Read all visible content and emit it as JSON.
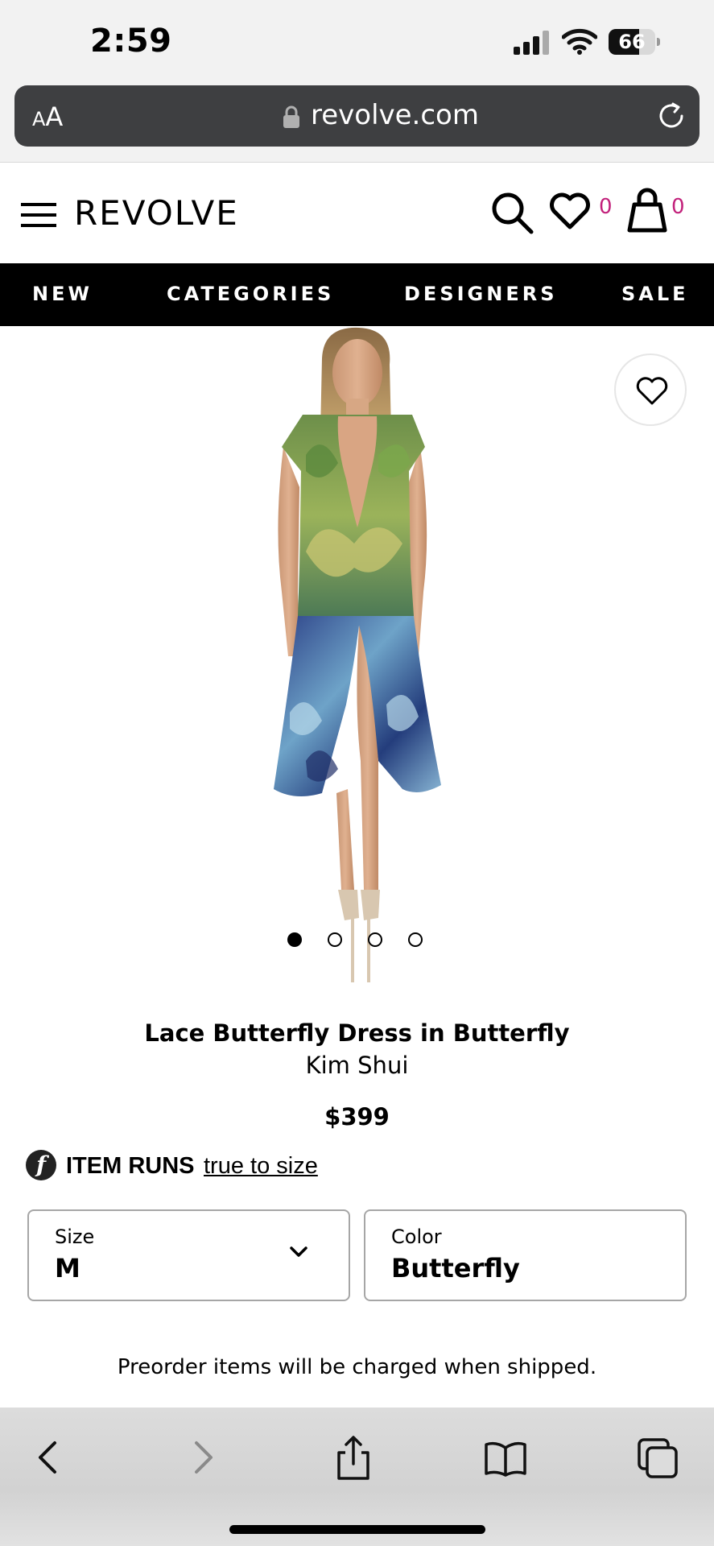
{
  "status_bar": {
    "time": "2:59",
    "battery": "66",
    "battery_level": 0.66
  },
  "browser": {
    "text_size_small": "A",
    "text_size_large": "A",
    "url": "revolve.com"
  },
  "site": {
    "logo": "REVOLVE",
    "wishlist_count": "0",
    "bag_count": "0"
  },
  "nav": {
    "items": [
      "NEW",
      "CATEGORIES",
      "DESIGNERS",
      "SALE"
    ]
  },
  "product": {
    "title": "Lace Butterfly Dress in Butterfly",
    "brand": "Kim Shui",
    "price": "$399",
    "image_count": 4,
    "active_image": 1
  },
  "fit": {
    "logo_letter": "f",
    "label": "ITEM RUNS",
    "link": "true to size"
  },
  "size_select": {
    "label": "Size",
    "value": "M"
  },
  "color_select": {
    "label": "Color",
    "value": "Butterfly"
  },
  "notice": "Preorder items will be charged when shipped.",
  "colors": {
    "accent": "#c2217b",
    "nav_bg": "#000000",
    "url_bar_bg": "#3e3f41"
  }
}
